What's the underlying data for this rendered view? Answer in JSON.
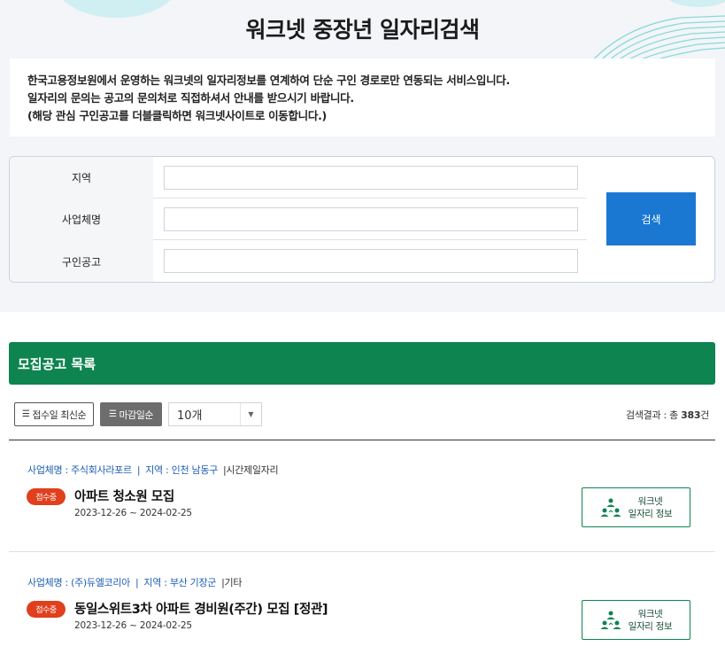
{
  "page_title": "워크넷 중장년 일자리검색",
  "notice": [
    "한국고용정보원에서 운영하는 워크넷의 일자리정보를 연계하여 단순 구인 경로로만 연동되는 서비스입니다.",
    "일자리의 문의는 공고의 문의처로 직접하셔서 안내를 받으시기 바랍니다.",
    "(해당 관심 구인공고를 더블클릭하면 워크넷사이트로 이동합니다.)"
  ],
  "search": {
    "region_label": "지역",
    "company_label": "사업체명",
    "posting_label": "구인공고",
    "region_value": "",
    "company_value": "",
    "posting_value": "",
    "button_label": "검색"
  },
  "list": {
    "header": "모집공고 목록",
    "sort_latest": "접수일 최신순",
    "sort_deadline": "마감일순",
    "count_select": "10개",
    "result_prefix": "검색결과 : 총 ",
    "result_count": "383",
    "result_suffix": "건"
  },
  "items": [
    {
      "company": "사업체명 : 주식회사라포르",
      "region": "지역 : 인천 남동구",
      "kind": "시간제일자리",
      "status": "접수중",
      "title": "아파트 청소원 모집",
      "date": "2023-12-26 ~ 2024-02-25",
      "button_line1": "워크넷",
      "button_line2": "일자리 정보"
    },
    {
      "company": "사업체명 : (주)듀엘코리아",
      "region": "지역 : 부산 기장군",
      "kind": "기타",
      "status": "접수중",
      "title": "동일스위트3차 아파트 경비원(주간) 모집 [정관]",
      "date": "2023-12-26 ~ 2024-02-25",
      "button_line1": "워크넷",
      "button_line2": "일자리 정보"
    }
  ],
  "colors": {
    "header_green": "#0e8450",
    "search_blue": "#1a78d2",
    "badge_red": "#e0401d",
    "meta_blue": "#1d5db3"
  },
  "icons": {
    "sort": "list-icon",
    "select": "chevron-down-icon",
    "worknet": "people-icon"
  }
}
